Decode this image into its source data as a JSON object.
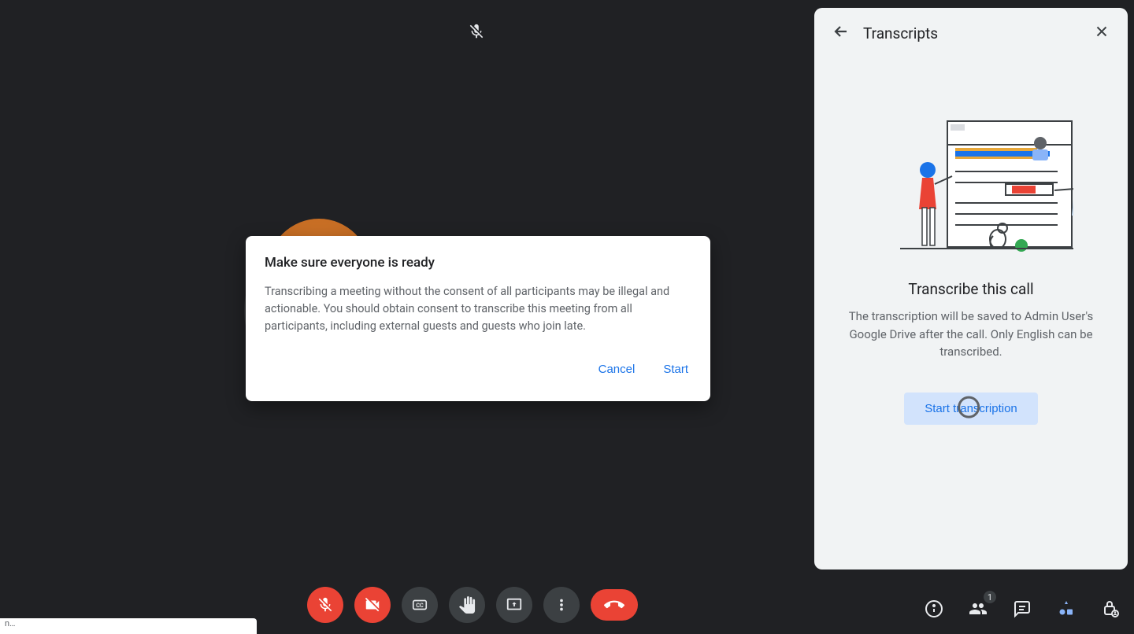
{
  "meeting": {
    "mic_muted": true
  },
  "dialog": {
    "title": "Make sure everyone is ready",
    "body": "Transcribing a meeting without the consent of all participants may be illegal and actionable. You should obtain consent to transcribe this meeting from all participants, including external guests and guests who join late.",
    "cancel_label": "Cancel",
    "start_label": "Start"
  },
  "controls": {
    "mic": "mic_off",
    "camera": "camera_off",
    "cc": "cc",
    "raise_hand": "raise_hand",
    "present": "present",
    "more": "more",
    "hangup": "hangup"
  },
  "info_bar": {
    "participant_count": "1"
  },
  "panel": {
    "title": "Transcripts",
    "heading": "Transcribe this call",
    "description": "The transcription will be saved to Admin User's Google Drive after the call. Only English can be transcribed.",
    "start_button": "Start transcription"
  },
  "corner_tab": "n…"
}
